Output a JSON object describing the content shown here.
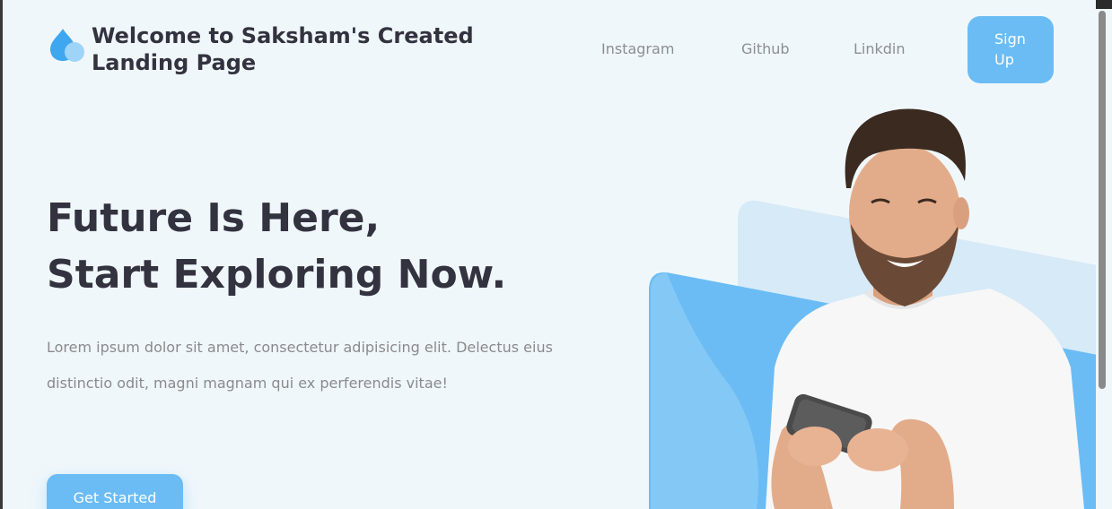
{
  "brand": {
    "title": "Welcome to Saksham's Created Landing Page",
    "logo_icon": "water-drops-icon"
  },
  "nav": {
    "links": [
      "Instagram",
      "Github",
      "Linkdin"
    ],
    "signup_label": "Sign Up"
  },
  "hero": {
    "title_line1": "Future Is Here,",
    "title_line2": "Start Exploring Now.",
    "description": "Lorem ipsum dolor sit amet, consectetur adipisicing elit. Delectus eius distinctio odit, magni magnam qui ex perferendis vitae!",
    "cta_label": "Get Started",
    "image": "man-smiling-at-phone-illustration"
  },
  "colors": {
    "accent": "#6bbcf4",
    "accent_light": "#d6eaf8",
    "background": "#f0f7fb",
    "heading": "#33323f",
    "muted_text": "#8a8a8e"
  }
}
